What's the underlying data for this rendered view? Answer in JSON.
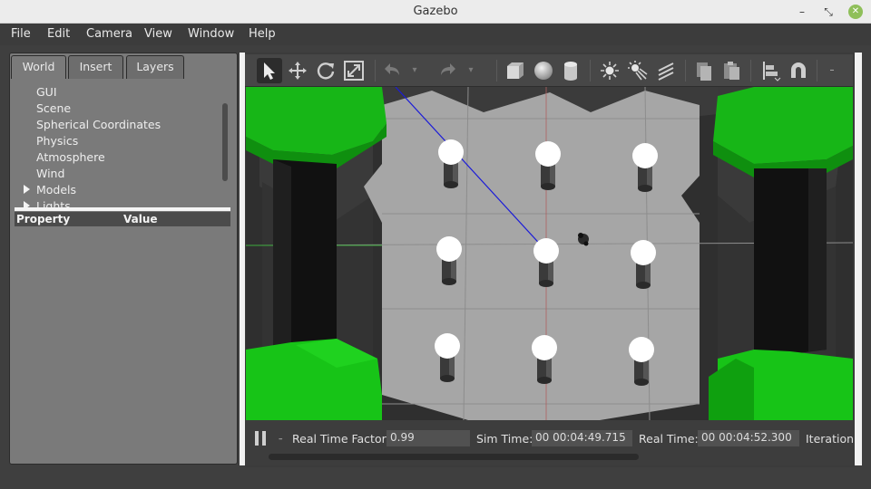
{
  "window": {
    "title": "Gazebo",
    "min_icon": "minimize-icon",
    "max_icon": "maximize-icon",
    "close_icon": "close-icon"
  },
  "menu": [
    "File",
    "Edit",
    "Camera",
    "View",
    "Window",
    "Help"
  ],
  "tabs": [
    "World",
    "Insert",
    "Layers"
  ],
  "tree": [
    "GUI",
    "Scene",
    "Spherical Coordinates",
    "Physics",
    "Atmosphere",
    "Wind",
    "Models",
    "Lights"
  ],
  "properties": {
    "col_property": "Property",
    "col_value": "Value"
  },
  "toolbar": {
    "icons": [
      "select-arrow-icon",
      "translate-icon",
      "rotate-icon",
      "scale-icon",
      "undo-icon",
      "undo-dropdown-icon",
      "redo-icon",
      "redo-dropdown-icon",
      "box-icon",
      "sphere-icon",
      "cylinder-icon",
      "point-light-icon",
      "spot-light-icon",
      "directional-light-icon",
      "copy-icon",
      "paste-icon",
      "align-icon",
      "magnet-icon",
      "more-icon"
    ]
  },
  "status": {
    "rtf_label": "Real Time Factor:",
    "rtf_value": "0.99",
    "sim_label": "Sim Time:",
    "sim_value": "00 00:04:49.715",
    "real_label": "Real Time:",
    "real_value": "00 00:04:52.300",
    "iter_label": "Iteration"
  },
  "colors": {
    "ground": "#a8a8a8",
    "green": "#1fc41f",
    "wall": "#3a3a3a",
    "axis_blue": "#1b1bd8"
  }
}
